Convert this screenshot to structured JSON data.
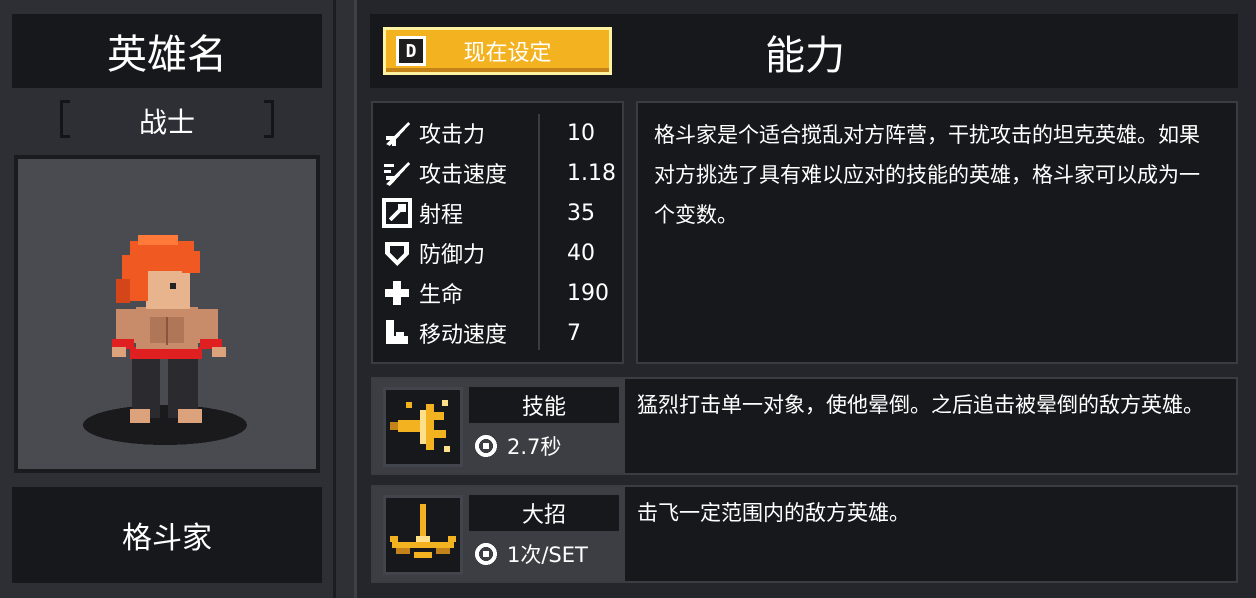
{
  "hero": {
    "name_header": "英雄名",
    "class_label": "战士",
    "hero_name": "格斗家"
  },
  "header": {
    "preset_key": "D",
    "preset_label": "现在设定",
    "section_title": "能力"
  },
  "stats": [
    {
      "icon": "attack-icon",
      "label": "攻击力",
      "value": "10"
    },
    {
      "icon": "attack-speed-icon",
      "label": "攻击速度",
      "value": "1.18"
    },
    {
      "icon": "range-icon",
      "label": "射程",
      "value": "35"
    },
    {
      "icon": "defense-icon",
      "label": "防御力",
      "value": "40"
    },
    {
      "icon": "health-icon",
      "label": "生命",
      "value": "190"
    },
    {
      "icon": "move-speed-icon",
      "label": "移动速度",
      "value": "7"
    }
  ],
  "description": "格斗家是个适合搅乱对方阵营，干扰攻击的坦克英雄。如果对方挑选了具有难以应对的技能的英雄，格斗家可以成为一个变数。",
  "skill": {
    "tag": "技能",
    "cooldown": "2.7秒",
    "description": "猛烈打击单一对象，使他晕倒。之后追击被晕倒的敌方英雄。"
  },
  "ultimate": {
    "tag": "大招",
    "cooldown": "1次/SET",
    "description": "击飞一定范围内的敌方英雄。"
  },
  "colors": {
    "accent_button": "#f3b321",
    "panel_dark": "#17181b",
    "panel_mid": "#3c3e44",
    "hair": "#f05a22",
    "belt": "#e02020"
  }
}
